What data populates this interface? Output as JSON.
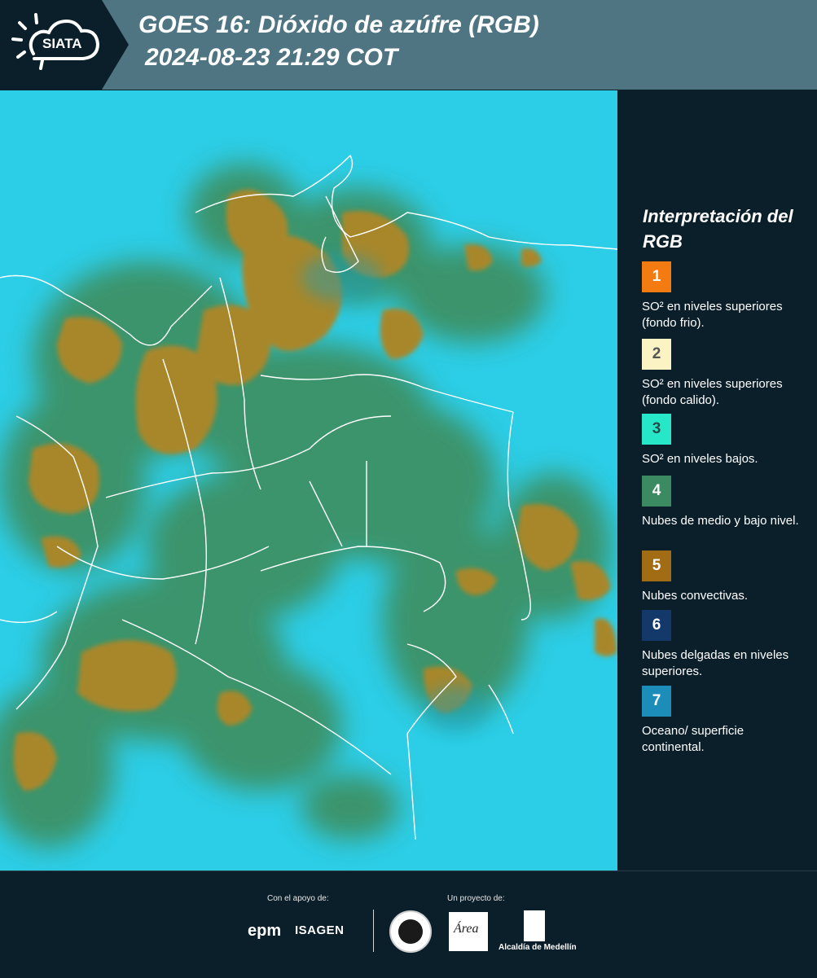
{
  "header": {
    "logo_text": "SIATA",
    "title_line1": "GOES 16: Dióxido de azúfre (RGB)",
    "title_line2": "2024-08-23 21:29 COT",
    "logo_icon": "sun-cloud-icon"
  },
  "map": {
    "description_colors": {
      "background_cyan": "#2fd0e6",
      "cloud_green": "#3b8f5a",
      "convective_brown": "#a78526",
      "borders": "#ffffff"
    }
  },
  "legend": {
    "title": "Interpretación del RGB",
    "items": [
      {
        "num": "1",
        "text": "SO² en niveles superiores (fondo frio).",
        "color": "#f47a12",
        "text_color": "#ffffff"
      },
      {
        "num": "2",
        "text": "SO² en niveles superiores (fondo calido).",
        "color": "#fbf3c3",
        "text_color": "#555555"
      },
      {
        "num": "3",
        "text": "SO² en niveles bajos.",
        "color": "#26e8c9",
        "text_color": "#2a4a4a"
      },
      {
        "num": "4",
        "text": "Nubes de medio y bajo nivel.",
        "color": "#3c8a62",
        "text_color": "#ffffff"
      },
      {
        "num": "5",
        "text": "Nubes convectivas.",
        "color": "#a26c15",
        "text_color": "#ffffff"
      },
      {
        "num": "6",
        "text": "Nubes delgadas en niveles superiores.",
        "color": "#13386a",
        "text_color": "#ffffff"
      },
      {
        "num": "7",
        "text": "Oceano/ superficie continental.",
        "color": "#1b8db8",
        "text_color": "#ffffff"
      }
    ]
  },
  "footer": {
    "support_label": "Con el apoyo de:",
    "project_label": "Un proyecto de:",
    "sponsor1": "epm",
    "sponsor2": "ISAGEN",
    "amva_text": "Área",
    "alcaldia": "Alcaldía de Medellín"
  }
}
